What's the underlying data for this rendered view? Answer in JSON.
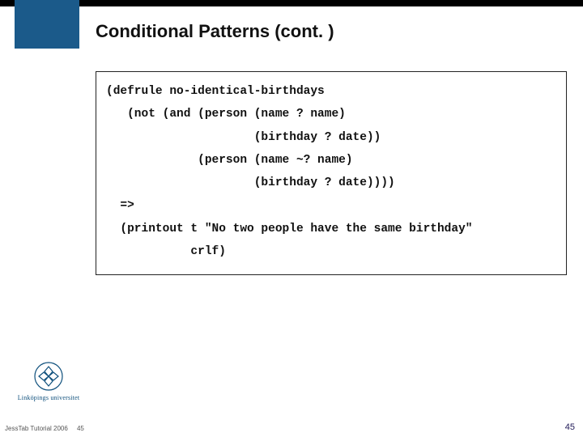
{
  "title": "Conditional Patterns (cont. )",
  "code": {
    "l1": "(defrule no-identical-birthdays",
    "l2": "   (not (and (person (name ? name)",
    "l3": "                     (birthday ? date))",
    "l4": "             (person (name ~? name)",
    "l5": "                     (birthday ? date))))",
    "l6": "  =>",
    "l7": "  (printout t \"No two people have the same birthday\"",
    "l8": "            crlf)"
  },
  "university": "Linköpings universitet",
  "footer": {
    "left": "JessTab Tutorial 2006",
    "page": "45"
  }
}
